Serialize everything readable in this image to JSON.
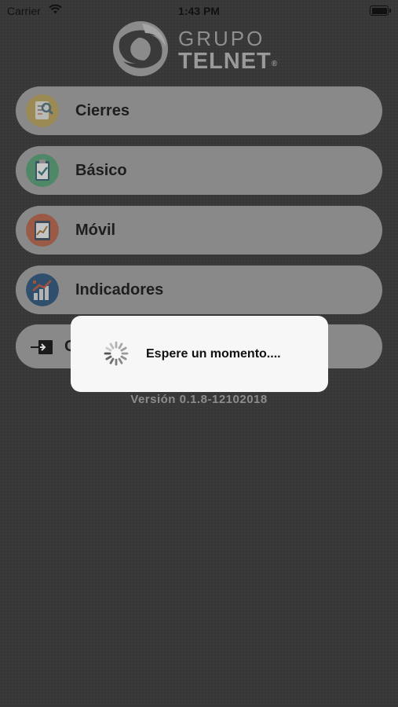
{
  "status_bar": {
    "carrier": "Carrier",
    "time": "1:43 PM"
  },
  "logo": {
    "line1": "GRUPO",
    "line2": "TELNET",
    "registered": "®"
  },
  "menu": {
    "items": [
      {
        "label": "Cierres",
        "icon": "document-search-icon"
      },
      {
        "label": "Básico",
        "icon": "clipboard-check-icon"
      },
      {
        "label": "Móvil",
        "icon": "tablet-chart-icon"
      },
      {
        "label": "Indicadores",
        "icon": "bar-chart-icon"
      },
      {
        "label": "C",
        "icon": "logout-icon"
      }
    ]
  },
  "version": "Versión  0.1.8-12102018",
  "dialog": {
    "message": "Espere un momento...."
  }
}
